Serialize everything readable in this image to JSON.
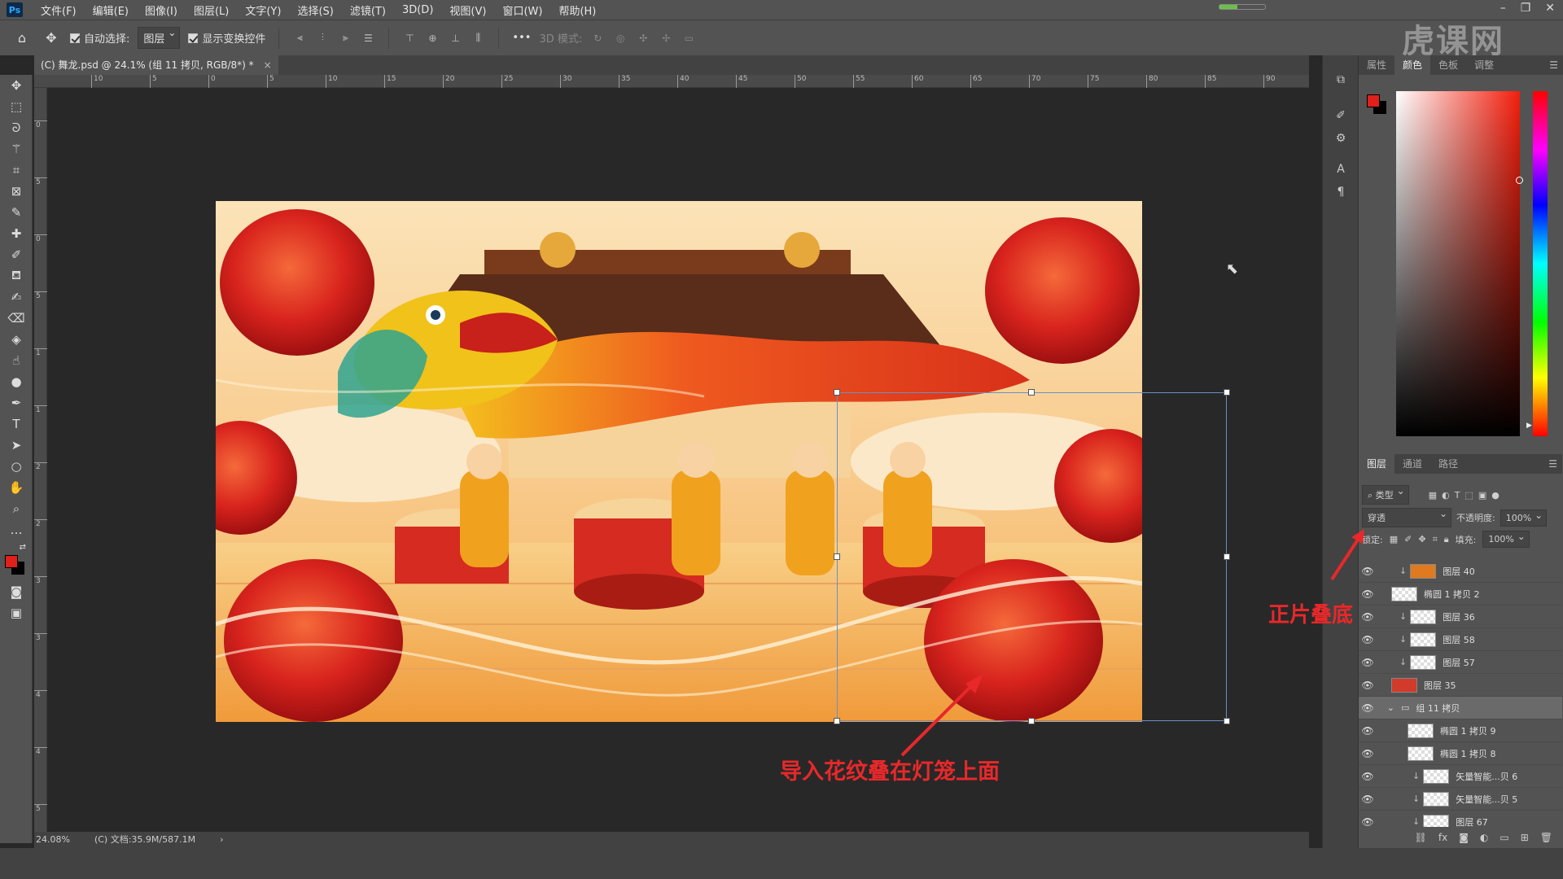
{
  "app": {
    "logo": "Ps",
    "menu": [
      "文件(F)",
      "编辑(E)",
      "图像(I)",
      "图层(L)",
      "文字(Y)",
      "选择(S)",
      "滤镜(T)",
      "3D(D)",
      "视图(V)",
      "窗口(W)",
      "帮助(H)"
    ],
    "watermark": "虎课网"
  },
  "options": {
    "auto_select_label": "自动选择:",
    "auto_select_target": "图层",
    "show_transform_label": "显示变换控件",
    "mode_3d_label": "3D 模式:",
    "more": "•••"
  },
  "document": {
    "tab_title": "(C) 舞龙.psd @ 24.1% (组 11 拷贝, RGB/8*) *",
    "close": "×"
  },
  "rulers": {
    "top": [
      "10",
      "5",
      "0",
      "5",
      "10",
      "15",
      "20",
      "25",
      "30",
      "35",
      "40",
      "45",
      "50",
      "55",
      "60",
      "65",
      "70",
      "75",
      "80",
      "85",
      "90"
    ],
    "left": [
      "0",
      "5",
      "0",
      "5",
      "1",
      "1",
      "2",
      "2",
      "3",
      "3",
      "4",
      "4",
      "5"
    ]
  },
  "status": {
    "zoom": "24.08%",
    "doc_info": "(C) 文档:35.9M/587.1M",
    "arrow": "›"
  },
  "annotations": {
    "multiply": "正片叠底",
    "import_pattern": "导入花纹叠在灯笼上面"
  },
  "color_panel": {
    "tabs": [
      "属性",
      "颜色",
      "色板",
      "调整"
    ],
    "active_tab": "颜色",
    "foreground": "#e0201b",
    "background": "#000000"
  },
  "layers_panel": {
    "tabs": [
      "图层",
      "通道",
      "路径"
    ],
    "active_tab": "图层",
    "filter_label": "类型",
    "blend_mode": "穿透",
    "opacity_label": "不透明度:",
    "opacity": "100%",
    "lock_label": "锁定:",
    "fill_label": "填充:",
    "fill": "100%",
    "layers": [
      {
        "name": "图层 40",
        "clipped": true,
        "indent": 1,
        "thumb": "#e07a1f"
      },
      {
        "name": "椭圆 1 拷贝 2",
        "clipped": false,
        "indent": 0,
        "thumb": ""
      },
      {
        "name": "图层 36",
        "clipped": true,
        "indent": 1,
        "thumb": ""
      },
      {
        "name": "图层 58",
        "clipped": true,
        "indent": 1,
        "thumb": ""
      },
      {
        "name": "图层 57",
        "clipped": true,
        "indent": 1,
        "thumb": ""
      },
      {
        "name": "图层 35",
        "clipped": false,
        "indent": 0,
        "thumb": "#d23a2a"
      },
      {
        "name": "组 11 拷贝",
        "clipped": false,
        "indent": 0,
        "group": true,
        "selected": true
      },
      {
        "name": "椭圆 1 拷贝 9",
        "clipped": false,
        "indent": 1,
        "thumb": ""
      },
      {
        "name": "椭圆 1 拷贝 8",
        "clipped": false,
        "indent": 1,
        "thumb": ""
      },
      {
        "name": "矢量智能...贝 6",
        "clipped": true,
        "indent": 2,
        "thumb": ""
      },
      {
        "name": "矢量智能...贝 5",
        "clipped": true,
        "indent": 2,
        "thumb": ""
      },
      {
        "name": "图层 67",
        "clipped": true,
        "indent": 2,
        "thumb": ""
      }
    ]
  }
}
